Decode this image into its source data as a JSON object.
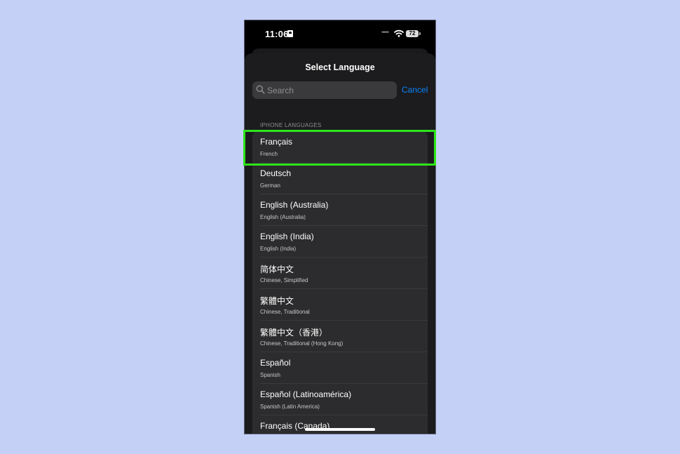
{
  "status_bar": {
    "time": "11:06",
    "battery": "72"
  },
  "sheet": {
    "title": "Select Language"
  },
  "search": {
    "placeholder": "Search",
    "value": ""
  },
  "cancel_label": "Cancel",
  "section_header": "IPHONE LANGUAGES",
  "languages": [
    {
      "name": "Français",
      "subtitle": "French"
    },
    {
      "name": "Deutsch",
      "subtitle": "German"
    },
    {
      "name": "English (Australia)",
      "subtitle": "English (Australia)"
    },
    {
      "name": "English (India)",
      "subtitle": "English (India)"
    },
    {
      "name": "简体中文",
      "subtitle": "Chinese, Simplified"
    },
    {
      "name": "繁體中文",
      "subtitle": "Chinese, Traditional"
    },
    {
      "name": "繁體中文（香港）",
      "subtitle": "Chinese, Traditional (Hong Kong)"
    },
    {
      "name": "Español",
      "subtitle": "Spanish"
    },
    {
      "name": "Español (Latinoamérica)",
      "subtitle": "Spanish (Latin America)"
    },
    {
      "name": "Français (Canada)",
      "subtitle": ""
    }
  ],
  "colors": {
    "background": "#c5d0f6",
    "accent": "#0a84ff",
    "highlight": "#2ee51b",
    "sheet": "#1c1c1e",
    "row": "#2c2c2e"
  },
  "icons": {
    "search": "search-icon",
    "wifi": "wifi-icon",
    "battery": "battery-icon"
  }
}
